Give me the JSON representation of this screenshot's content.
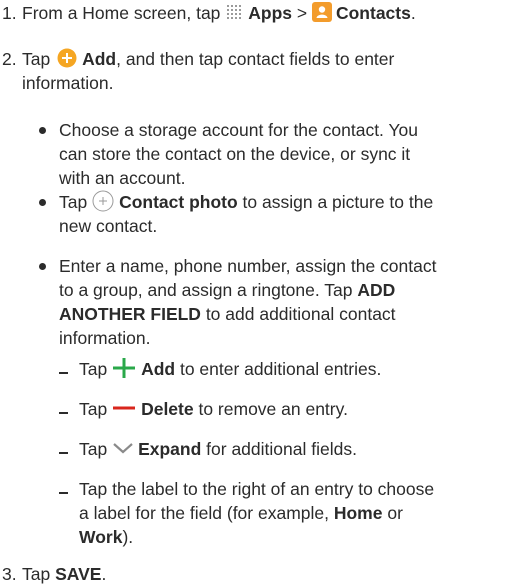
{
  "step1": {
    "num": "1.",
    "pre": "From a Home screen, tap ",
    "apps": "Apps",
    "sep": " > ",
    "contacts": "Contacts",
    "end": "."
  },
  "step2": {
    "num": "2.",
    "pre": "Tap ",
    "add": "Add",
    "post": ", and then tap contact fields to enter",
    "line2": "information."
  },
  "bullet1": {
    "l1": "Choose a storage account for the contact. You",
    "l2": "can store the contact on the device, or sync it",
    "l3": "with an account."
  },
  "bullet2": {
    "pre": "Tap ",
    "bold": "Contact photo",
    "post": " to assign a picture to the",
    "l2": "new contact."
  },
  "bullet3": {
    "l1": "Enter a name, phone number, assign the contact",
    "l2": "to a group, and assign a ringtone. Tap ",
    "l2bold": "ADD",
    "l3bold": "ANOTHER FIELD",
    "l3": " to add additional contact",
    "l4": "information."
  },
  "sub1": {
    "pre": "Tap ",
    "bold": "Add",
    "post": " to enter additional entries."
  },
  "sub2": {
    "pre": "Tap ",
    "bold": "Delete",
    "post": " to remove an entry."
  },
  "sub3": {
    "pre": "Tap ",
    "bold": "Expand",
    "post": " for additional fields."
  },
  "sub4": {
    "l1": "Tap the label to the right of an entry to choose",
    "l2pre": "a label for the field (for example, ",
    "home": "Home",
    "or": " or",
    "work": "Work",
    "end": ")."
  },
  "step3": {
    "num": "3.",
    "pre": "Tap ",
    "save": "SAVE",
    "end": "."
  },
  "colors": {
    "add_orange": "#f5a623",
    "contacts_orange": "#f39c2c",
    "plus_green": "#2aa84a",
    "minus_red": "#d9261c",
    "chevron_gray": "#8a8a8a",
    "apps_gray": "#9a9a9a"
  }
}
